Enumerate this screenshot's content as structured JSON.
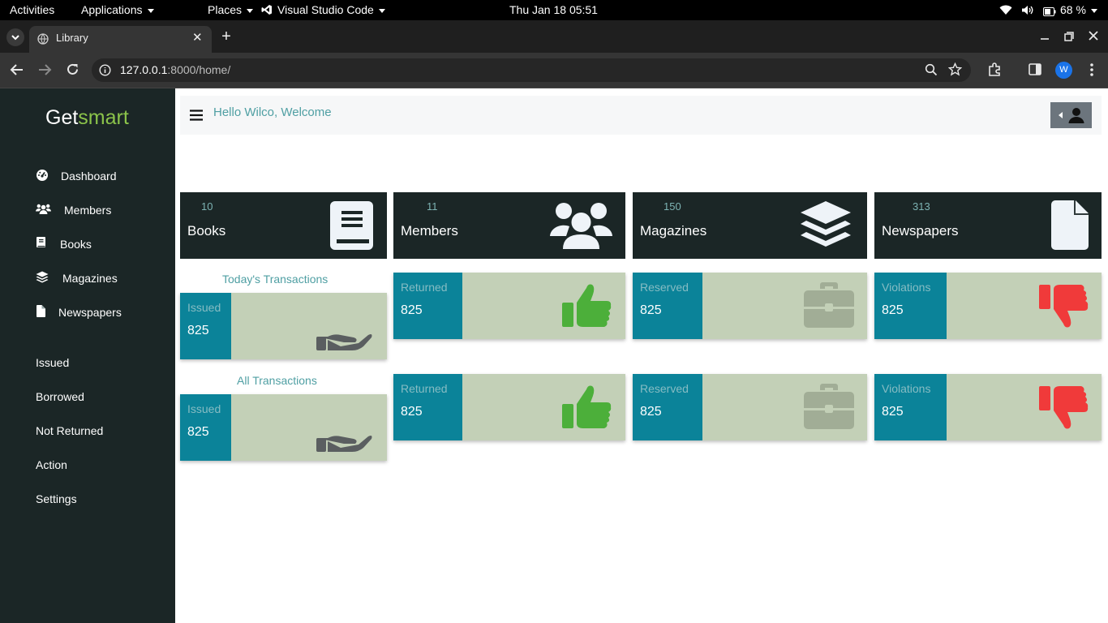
{
  "system_bar": {
    "activities": "Activities",
    "applications": "Applications",
    "places": "Places",
    "app_name": "Visual Studio Code",
    "datetime": "Thu Jan 18  05:51",
    "battery": "68 %"
  },
  "browser": {
    "tab_title": "Library",
    "url_host": "127.0.0.1",
    "url_rest": ":8000/home/",
    "profile_initial": "W"
  },
  "brand": {
    "part1": "Get",
    "part2": "smart"
  },
  "sidebar": {
    "items": [
      {
        "label": "Dashboard",
        "icon": "gauge-icon"
      },
      {
        "label": "Members",
        "icon": "users-icon"
      },
      {
        "label": "Books",
        "icon": "book-icon"
      },
      {
        "label": "Magazines",
        "icon": "layers-icon"
      },
      {
        "label": "Newspapers",
        "icon": "file-icon"
      },
      {
        "label": "Issued"
      },
      {
        "label": "Borrowed"
      },
      {
        "label": "Not Returned"
      },
      {
        "label": "Action"
      },
      {
        "label": "Settings"
      }
    ]
  },
  "header": {
    "greeting": "Hello Wilco, Welcome"
  },
  "stats": [
    {
      "count": "10",
      "label": "Books",
      "icon": "book-icon"
    },
    {
      "count": "11",
      "label": "Members",
      "icon": "users-icon"
    },
    {
      "count": "150",
      "label": "Magazines",
      "icon": "layers-icon"
    },
    {
      "count": "313",
      "label": "Newspapers",
      "icon": "file-icon"
    }
  ],
  "today": {
    "title": "Today's Transactions",
    "issued": {
      "label": "Issued",
      "value": "825"
    },
    "returned": {
      "label": "Returned",
      "value": "825"
    },
    "reserved": {
      "label": "Reserved",
      "value": "825"
    },
    "violations": {
      "label": "Violations",
      "value": "825"
    }
  },
  "all": {
    "title": "All Transactions",
    "issued": {
      "label": "Issued",
      "value": "825"
    },
    "returned": {
      "label": "Returned",
      "value": "825"
    },
    "reserved": {
      "label": "Reserved",
      "value": "825"
    },
    "violations": {
      "label": "Violations",
      "value": "825"
    }
  },
  "colors": {
    "sidebar": "#1b2626",
    "accent_green": "#8bc34a",
    "card_bg": "#c3d0b7",
    "strip": "#0b8399",
    "thumbs_up": "#4caf3a",
    "thumbs_down": "#f03a3a"
  }
}
